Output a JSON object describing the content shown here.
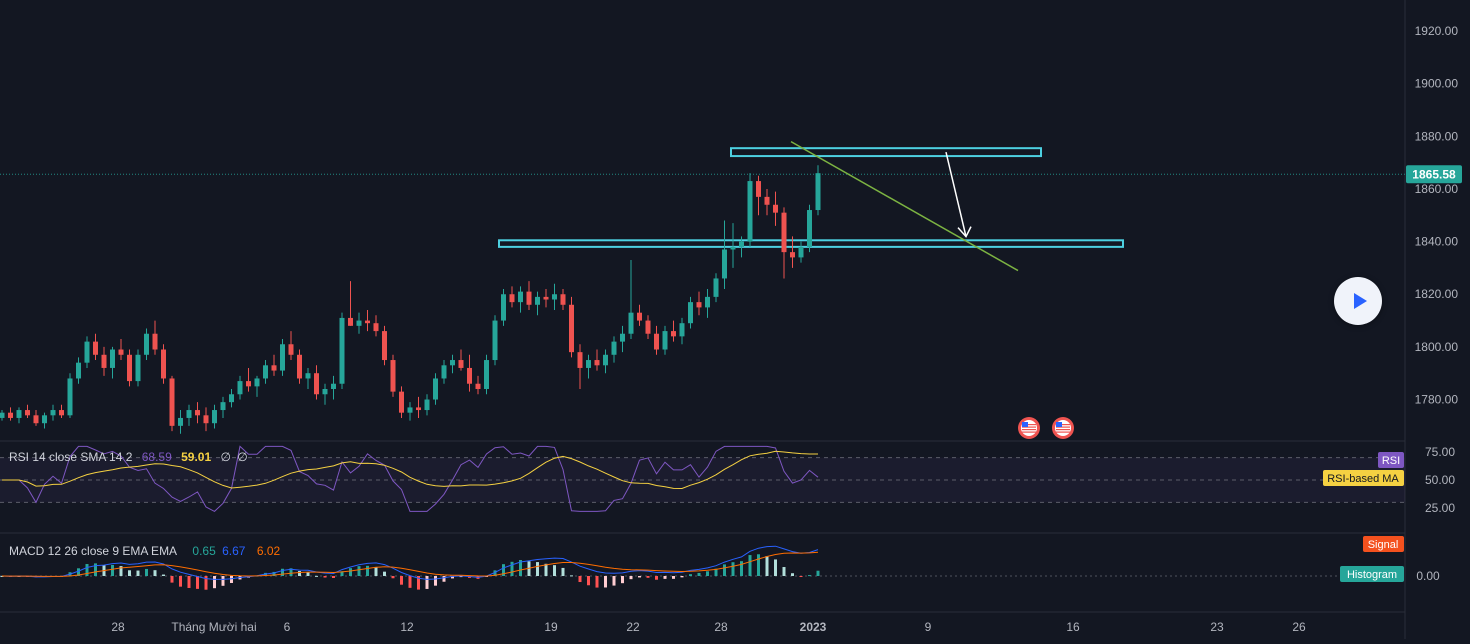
{
  "chart_data": {
    "type": "candlestick",
    "x_ticks": [
      "28",
      "Tháng Mười hai",
      "6",
      "12",
      "19",
      "22",
      "28",
      "2023",
      "9",
      "16",
      "23",
      "26"
    ],
    "price_axis": {
      "ticks": [
        "1920.00",
        "1900.00",
        "1880.00",
        "1860.00",
        "1840.00",
        "1820.00",
        "1800.00",
        "1780.00"
      ],
      "ylim": [
        1765,
        1928
      ]
    },
    "last_price": "1865.58",
    "candles": [
      [
        1773,
        1776,
        1772,
        1775
      ],
      [
        1775,
        1777,
        1772,
        1773
      ],
      [
        1773,
        1777,
        1771,
        1776
      ],
      [
        1776,
        1778,
        1773,
        1774
      ],
      [
        1774,
        1776,
        1770,
        1771
      ],
      [
        1771,
        1775,
        1769,
        1774
      ],
      [
        1774,
        1778,
        1772,
        1776
      ],
      [
        1776,
        1778,
        1773,
        1774
      ],
      [
        1774,
        1790,
        1773,
        1788
      ],
      [
        1788,
        1796,
        1786,
        1794
      ],
      [
        1794,
        1804,
        1792,
        1802
      ],
      [
        1802,
        1805,
        1795,
        1797
      ],
      [
        1797,
        1800,
        1789,
        1792
      ],
      [
        1792,
        1800,
        1788,
        1799
      ],
      [
        1799,
        1803,
        1795,
        1797
      ],
      [
        1797,
        1799,
        1785,
        1787
      ],
      [
        1787,
        1799,
        1785,
        1797
      ],
      [
        1797,
        1807,
        1795,
        1805
      ],
      [
        1805,
        1810,
        1797,
        1799
      ],
      [
        1799,
        1801,
        1786,
        1788
      ],
      [
        1788,
        1789,
        1768,
        1770
      ],
      [
        1770,
        1776,
        1767,
        1773
      ],
      [
        1773,
        1778,
        1770,
        1776
      ],
      [
        1776,
        1779,
        1771,
        1774
      ],
      [
        1774,
        1777,
        1768,
        1771
      ],
      [
        1771,
        1778,
        1769,
        1776
      ],
      [
        1776,
        1781,
        1773,
        1779
      ],
      [
        1779,
        1784,
        1777,
        1782
      ],
      [
        1782,
        1789,
        1780,
        1787
      ],
      [
        1787,
        1792,
        1783,
        1785
      ],
      [
        1785,
        1789,
        1781,
        1788
      ],
      [
        1788,
        1795,
        1786,
        1793
      ],
      [
        1793,
        1797,
        1789,
        1791
      ],
      [
        1791,
        1803,
        1789,
        1801
      ],
      [
        1801,
        1806,
        1795,
        1797
      ],
      [
        1797,
        1799,
        1786,
        1788
      ],
      [
        1788,
        1792,
        1784,
        1790
      ],
      [
        1790,
        1793,
        1780,
        1782
      ],
      [
        1782,
        1786,
        1778,
        1784
      ],
      [
        1784,
        1789,
        1780,
        1786
      ],
      [
        1786,
        1813,
        1784,
        1811
      ],
      [
        1811,
        1825,
        1808,
        1808
      ],
      [
        1808,
        1813,
        1805,
        1810
      ],
      [
        1810,
        1814,
        1806,
        1809
      ],
      [
        1809,
        1812,
        1804,
        1806
      ],
      [
        1806,
        1808,
        1793,
        1795
      ],
      [
        1795,
        1797,
        1781,
        1783
      ],
      [
        1783,
        1785,
        1773,
        1775
      ],
      [
        1775,
        1779,
        1772,
        1777
      ],
      [
        1777,
        1781,
        1773,
        1776
      ],
      [
        1776,
        1782,
        1774,
        1780
      ],
      [
        1780,
        1790,
        1778,
        1788
      ],
      [
        1788,
        1795,
        1786,
        1793
      ],
      [
        1793,
        1797,
        1790,
        1795
      ],
      [
        1795,
        1799,
        1791,
        1792
      ],
      [
        1792,
        1797,
        1783,
        1786
      ],
      [
        1786,
        1789,
        1782,
        1784
      ],
      [
        1784,
        1797,
        1782,
        1795
      ],
      [
        1795,
        1812,
        1793,
        1810
      ],
      [
        1810,
        1822,
        1808,
        1820
      ],
      [
        1820,
        1823,
        1815,
        1817
      ],
      [
        1817,
        1823,
        1813,
        1821
      ],
      [
        1821,
        1825,
        1814,
        1816
      ],
      [
        1816,
        1821,
        1812,
        1819
      ],
      [
        1819,
        1822,
        1815,
        1818
      ],
      [
        1818,
        1824,
        1814,
        1820
      ],
      [
        1820,
        1822,
        1814,
        1816
      ],
      [
        1816,
        1819,
        1796,
        1798
      ],
      [
        1798,
        1801,
        1784,
        1792
      ],
      [
        1792,
        1797,
        1788,
        1795
      ],
      [
        1795,
        1799,
        1791,
        1793
      ],
      [
        1793,
        1799,
        1790,
        1797
      ],
      [
        1797,
        1804,
        1794,
        1802
      ],
      [
        1802,
        1808,
        1798,
        1805
      ],
      [
        1805,
        1833,
        1803,
        1813
      ],
      [
        1813,
        1816,
        1808,
        1810
      ],
      [
        1810,
        1812,
        1803,
        1805
      ],
      [
        1805,
        1808,
        1797,
        1799
      ],
      [
        1799,
        1808,
        1797,
        1806
      ],
      [
        1806,
        1810,
        1802,
        1804
      ],
      [
        1804,
        1811,
        1801,
        1809
      ],
      [
        1809,
        1819,
        1807,
        1817
      ],
      [
        1817,
        1821,
        1812,
        1815
      ],
      [
        1815,
        1822,
        1811,
        1819
      ],
      [
        1819,
        1828,
        1817,
        1826
      ],
      [
        1826,
        1848,
        1822,
        1837
      ],
      [
        1837,
        1847,
        1830,
        1838
      ],
      [
        1838,
        1842,
        1834,
        1840
      ],
      [
        1840,
        1866,
        1838,
        1863
      ],
      [
        1863,
        1865,
        1850,
        1857
      ],
      [
        1857,
        1860,
        1850,
        1854
      ],
      [
        1854,
        1859,
        1846,
        1851
      ],
      [
        1851,
        1853,
        1826,
        1836
      ],
      [
        1836,
        1842,
        1830,
        1834
      ],
      [
        1834,
        1840,
        1832,
        1838
      ],
      [
        1838,
        1854,
        1836,
        1852
      ],
      [
        1852,
        1869,
        1850,
        1866
      ]
    ],
    "support_zones": [
      {
        "from": 1872.5,
        "to": 1875.5
      },
      {
        "from": 1838,
        "to": 1840.5
      }
    ],
    "trendline": {
      "from": [
        86,
        1878
      ],
      "to": [
        108,
        1829
      ]
    },
    "arrow": {
      "from": [
        103,
        1874
      ],
      "to": [
        105,
        1840
      ]
    },
    "rsi": {
      "label": "RSI 14 close SMA 14 2",
      "values": [
        "68.59",
        "59.01",
        "∅",
        "∅"
      ],
      "axis_ticks": [
        "75.00",
        "50.00",
        "25.00"
      ],
      "levels": [
        70,
        50,
        30
      ],
      "badges": [
        "RSI",
        "RSI-based MA"
      ]
    },
    "macd": {
      "label": "MACD 12 26 close 9 EMA EMA",
      "values": [
        "0.65",
        "6.67",
        "6.02"
      ],
      "axis_ticks": [
        "0.00"
      ],
      "badges": [
        "Signal",
        "Histogram"
      ]
    },
    "colors": {
      "up": "#26a69a",
      "down": "#ef5350",
      "background": "#131722",
      "zone": "#4dd0e1",
      "trendline": "#7cb342",
      "rsi": "#7e57c2",
      "rsi_ma": "#f5d142",
      "macd": "#2962ff",
      "signal": "#ff6d00"
    }
  }
}
